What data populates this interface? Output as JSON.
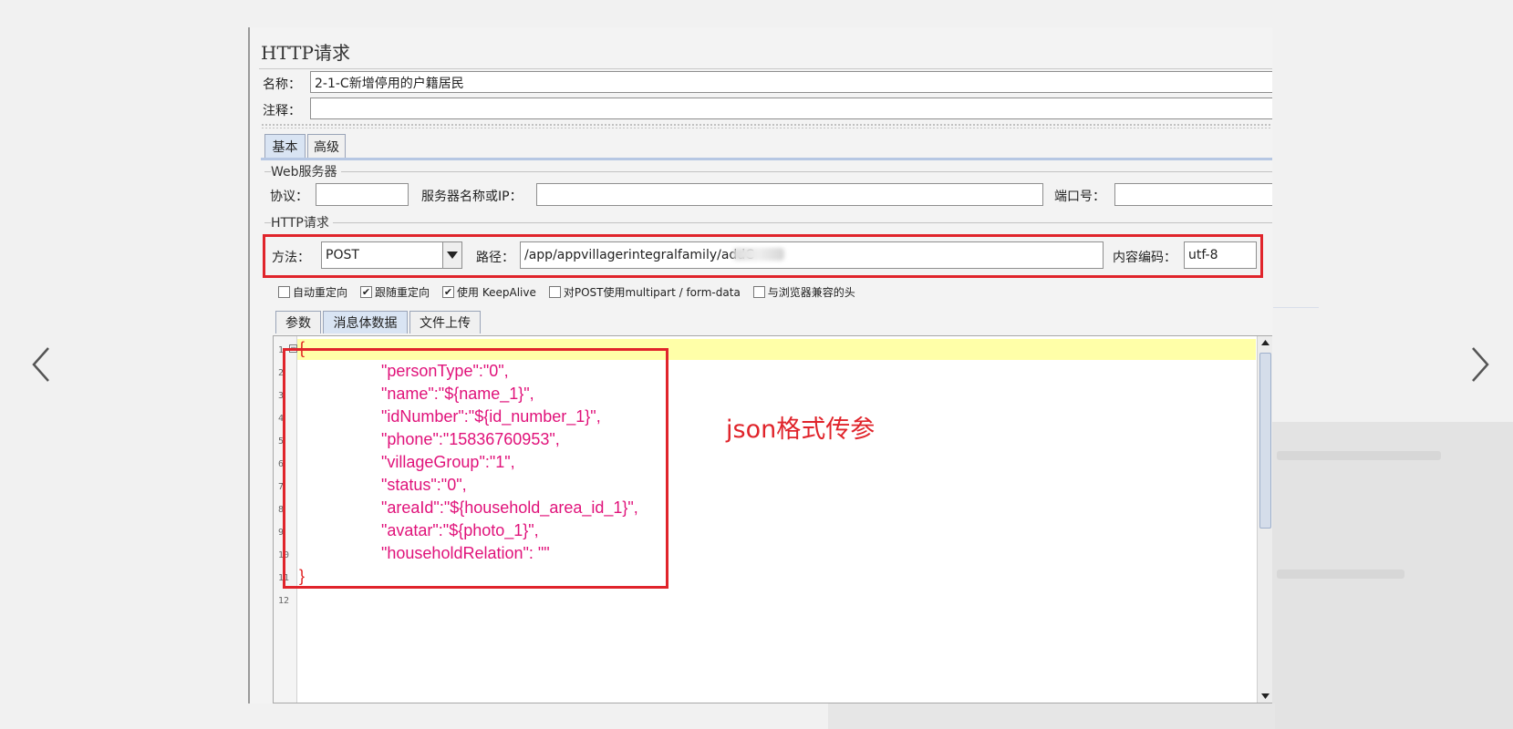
{
  "title": "HTTP请求",
  "name_label": "名称：",
  "name_value": "2-1-C新增停用的户籍居民",
  "comment_label": "注释：",
  "comment_value": "",
  "tabs": [
    {
      "label": "基本",
      "active": true
    },
    {
      "label": "高级",
      "active": false
    }
  ],
  "web_server": {
    "group_title": "Web服务器",
    "protocol_label": "协议：",
    "protocol_value": "",
    "server_label": "服务器名称或IP：",
    "server_value": "",
    "port_label": "端口号：",
    "port_value": ""
  },
  "http_request": {
    "group_title": "HTTP请求",
    "method_label": "方法：",
    "method_value": "POST",
    "path_label": "路径：",
    "path_value": "/app/appvillagerintegralfamily/addC",
    "encoding_label": "内容编码：",
    "encoding_value": "utf-8"
  },
  "options": [
    {
      "label": "自动重定向",
      "checked": false
    },
    {
      "label": "跟随重定向",
      "checked": true
    },
    {
      "label": "使用 KeepAlive",
      "checked": true
    },
    {
      "label": "对POST使用multipart / form-data",
      "checked": false
    },
    {
      "label": "与浏览器兼容的头",
      "checked": false
    }
  ],
  "body_tabs": [
    {
      "label": "参数",
      "active": false
    },
    {
      "label": "消息体数据",
      "active": true
    },
    {
      "label": "文件上传",
      "active": false
    }
  ],
  "editor": {
    "line_numbers": [
      "1",
      "2",
      "3",
      "4",
      "5",
      "6",
      "7",
      "8",
      "9",
      "10",
      "11",
      "12"
    ],
    "open_brace": "{",
    "close_brace": "}",
    "lines": [
      "\"personType\":\"0\",",
      "\"name\":\"${name_1}\",",
      "\"idNumber\":\"${id_number_1}\",",
      "\"phone\":\"15836760953\",",
      "\"villageGroup\":\"1\",",
      "\"status\":\"0\",",
      "\"areaId\":\"${household_area_id_1}\",",
      "\"avatar\":\"${photo_1}\",",
      "\"householdRelation\": \"\""
    ]
  },
  "annotation": "json格式传参",
  "colors": {
    "highlight_red": "#e0242b",
    "code_magenta": "#e0127a",
    "current_line": "#ffffa8"
  },
  "icons": {
    "prev": "chevron-left-icon",
    "next": "chevron-right-icon",
    "dropdown": "triangle-down-icon"
  }
}
